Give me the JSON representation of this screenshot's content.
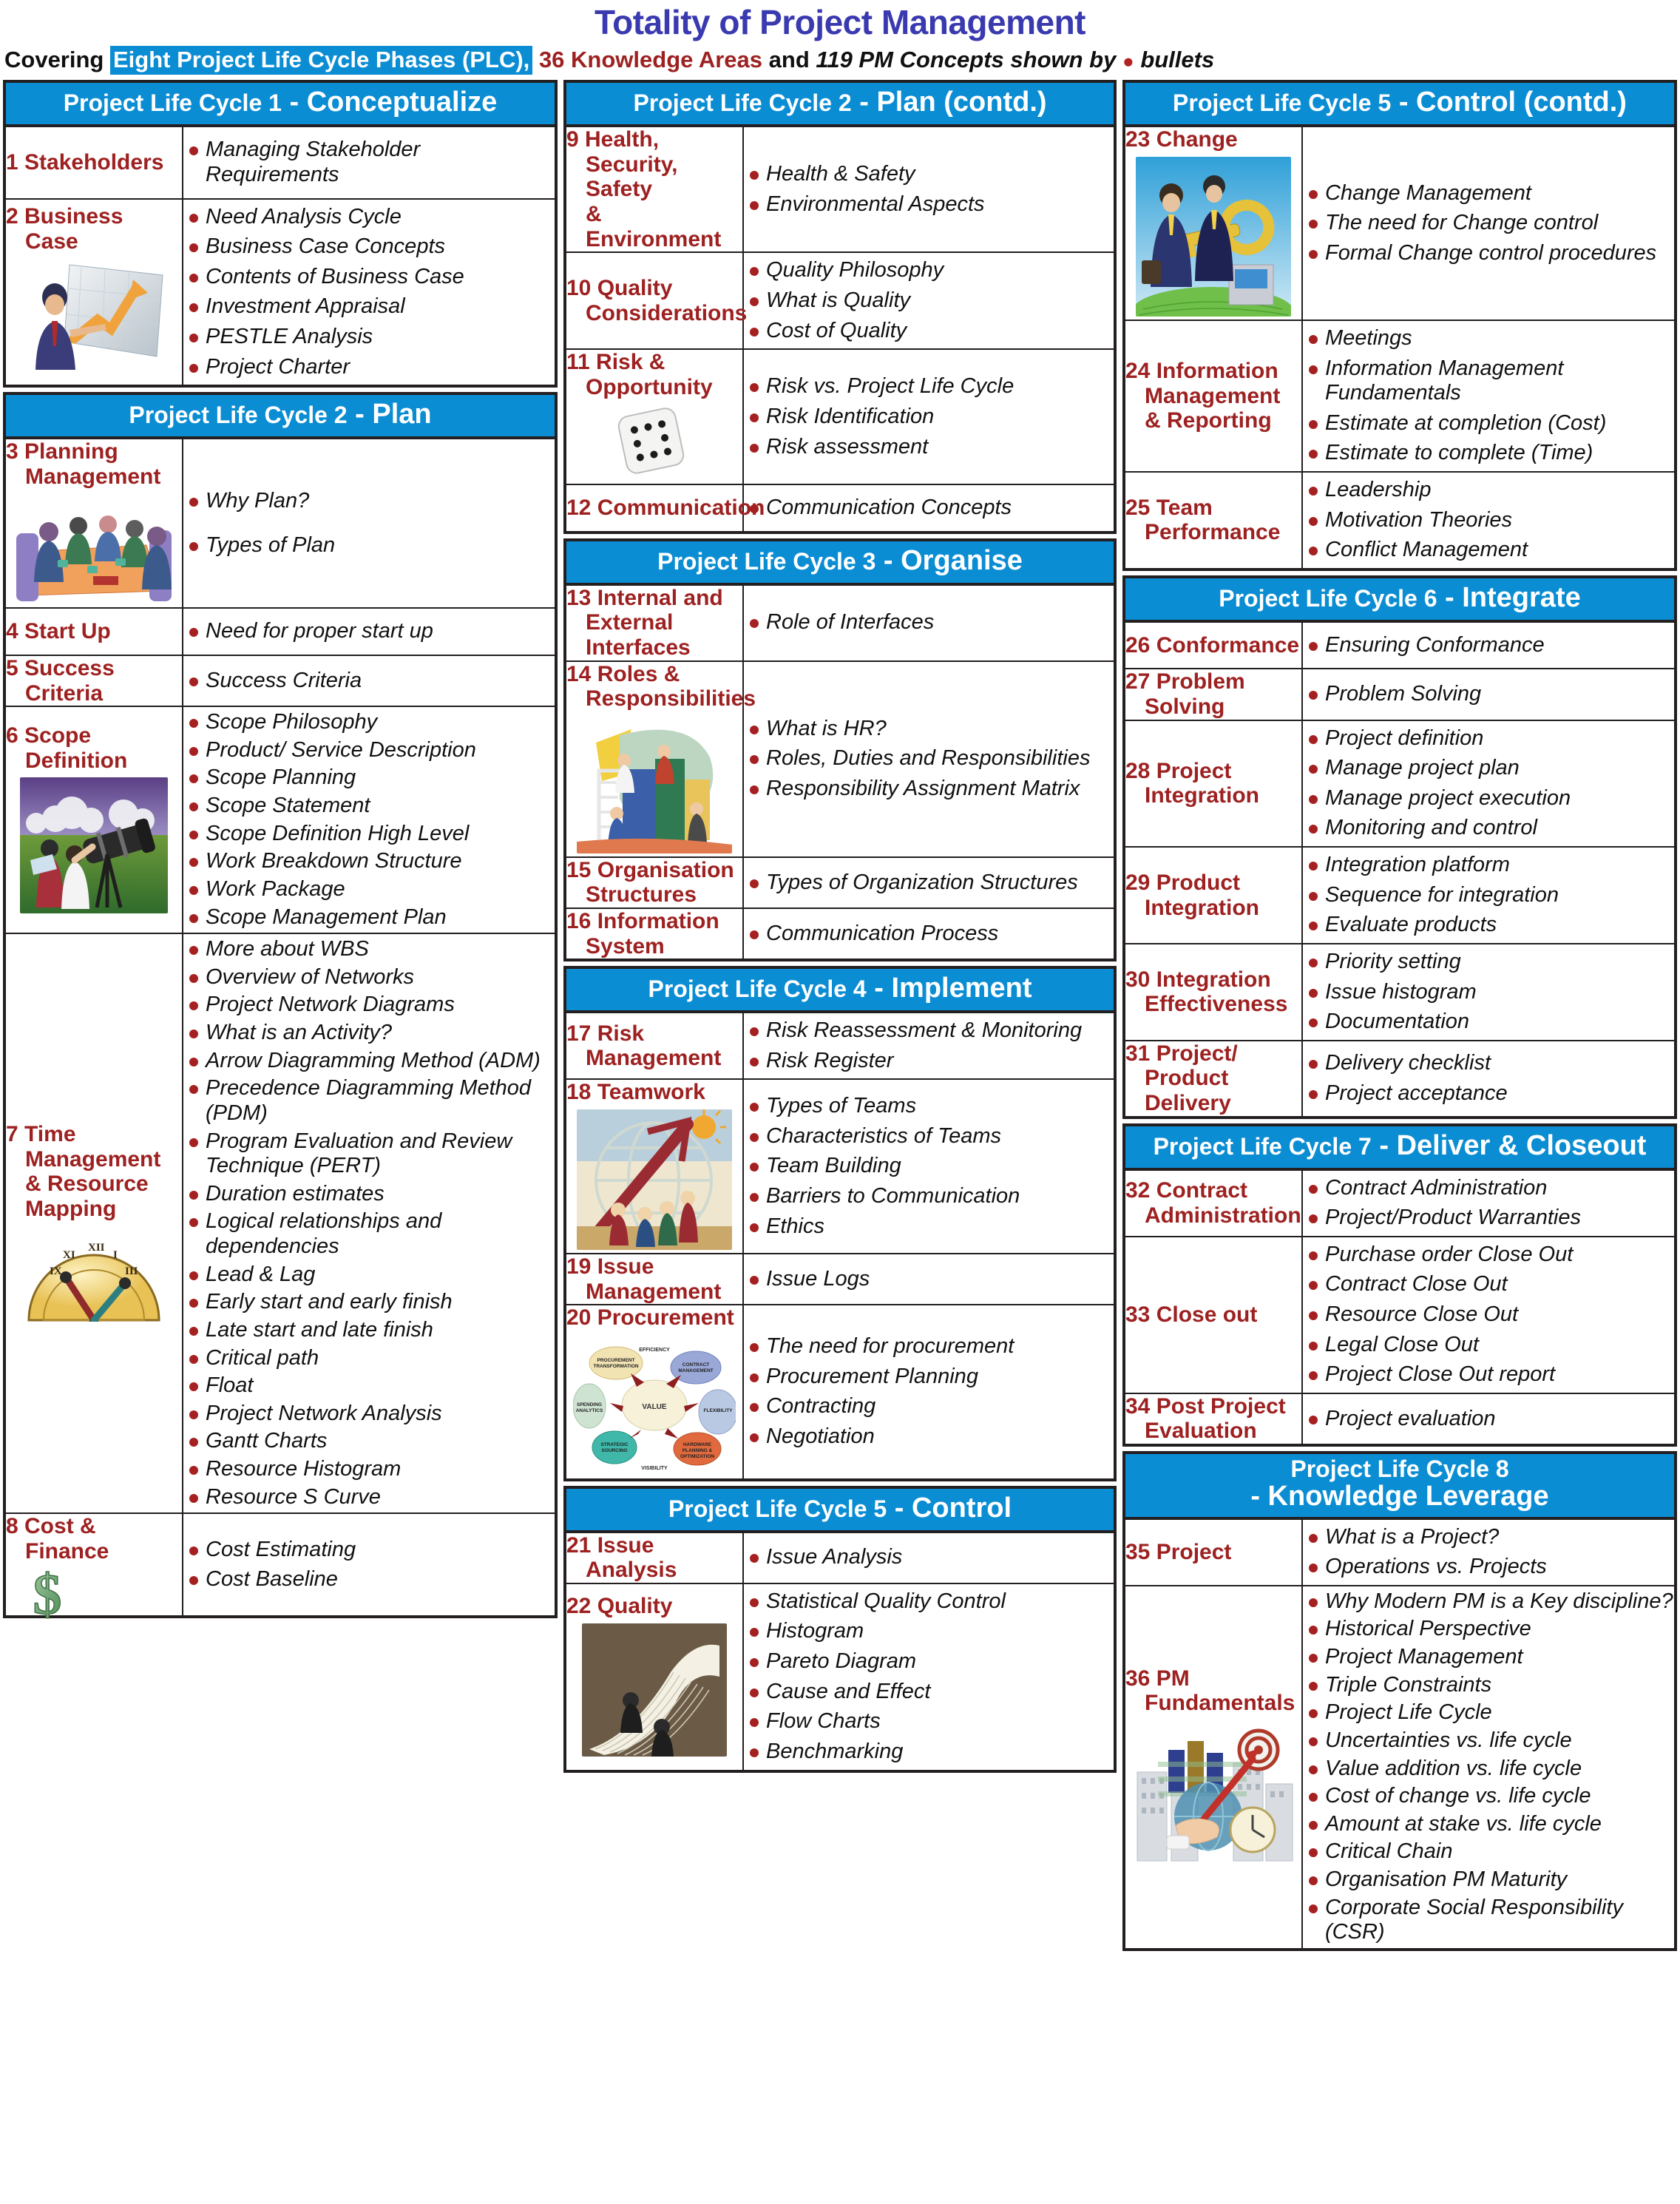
{
  "header": {
    "title": "Totality of Project Management",
    "subtitle": {
      "covering": "Covering",
      "phases": "Eight Project Life Cycle Phases (PLC),",
      "knowledge_areas": "36 Knowledge Areas",
      "and": "and",
      "concepts": "119 PM Concepts shown by",
      "bullets": "bullets"
    }
  },
  "colors": {
    "plc_bar": "#0b8dd3",
    "knowledge_area": "#9e2121",
    "title": "#3a3ab0",
    "bullet": "#a52020",
    "border": "#231f20"
  },
  "columns": [
    {
      "id": "column-1",
      "blocks": [
        {
          "phase_prefix": "Project Life Cycle 1",
          "phase_name": "- Conceptualize",
          "areas": [
            {
              "num": "1",
              "name": "Stakeholders",
              "art": "none",
              "concepts": [
                "Managing Stakeholder Requirements"
              ]
            },
            {
              "num": "2",
              "name": "Business",
              "name2": "Case",
              "art": "businessman-chart",
              "concepts": [
                "Need Analysis Cycle",
                "Business Case Concepts",
                "Contents of Business Case",
                "Investment Appraisal",
                "PESTLE Analysis",
                "Project Charter"
              ]
            }
          ]
        },
        {
          "phase_prefix": "Project Life Cycle 2",
          "phase_name": "- Plan",
          "areas": [
            {
              "num": "3",
              "name": "Planning",
              "name2": "Management",
              "art": "meeting-table",
              "concepts": [
                "Why Plan?",
                "Types of Plan"
              ]
            },
            {
              "num": "4",
              "name": "Start Up",
              "art": "none",
              "concepts": [
                "Need for proper start up"
              ]
            },
            {
              "num": "5",
              "name": "Success",
              "name2": "Criteria",
              "art": "none",
              "concepts": [
                "Success Criteria"
              ]
            },
            {
              "num": "6",
              "name": "Scope",
              "name2": "Definition",
              "art": "telescope-field",
              "concepts": [
                "Scope Philosophy",
                "Product/ Service Description",
                "Scope Planning",
                "Scope Statement",
                "Scope Definition High Level",
                "Work Breakdown Structure",
                "Work Package",
                "Scope Management Plan"
              ]
            },
            {
              "num": "7",
              "name": "Time",
              "name2": "Management",
              "name3": "& Resource",
              "name4": "Mapping",
              "art": "clock-dial",
              "concepts": [
                "More about WBS",
                "Overview of Networks",
                "Project Network Diagrams",
                "What is an Activity?",
                "Arrow Diagramming Method (ADM)",
                "Precedence Diagramming Method (PDM)",
                "Program Evaluation and Review Technique (PERT)",
                "Duration estimates",
                "Logical relationships and dependencies",
                "Lead & Lag",
                "Early start and early finish",
                "Late start and late finish",
                "Critical path",
                "Float",
                "Project Network Analysis",
                "Gantt Charts",
                "Resource Histogram",
                "Resource S Curve"
              ]
            },
            {
              "num": "8",
              "name": "Cost &",
              "name2": "Finance",
              "art": "dollar-sign",
              "concepts": [
                "Cost Estimating",
                "Cost Baseline"
              ]
            }
          ]
        }
      ]
    },
    {
      "id": "column-2",
      "blocks": [
        {
          "phase_prefix": "Project Life Cycle 2",
          "phase_name": "- Plan (contd.)",
          "areas": [
            {
              "num": "9",
              "name": "Health,",
              "name2": "Security, Safety",
              "name3": "& Environment",
              "art": "none",
              "concepts": [
                "Health & Safety",
                "Environmental Aspects"
              ]
            },
            {
              "num": "10",
              "name": "Quality",
              "name2": "Considerations",
              "art": "none",
              "concepts": [
                "Quality Philosophy",
                "What is Quality",
                "Cost of Quality"
              ]
            },
            {
              "num": "11",
              "name": "Risk &",
              "name2": "Opportunity",
              "art": "dice",
              "concepts": [
                "Risk vs. Project Life Cycle",
                "Risk Identification",
                "Risk assessment"
              ]
            },
            {
              "num": "12",
              "name": "Communication",
              "art": "none",
              "concepts": [
                "Communication Concepts"
              ]
            }
          ]
        },
        {
          "phase_prefix": "Project Life Cycle 3",
          "phase_name": "- Organise",
          "areas": [
            {
              "num": "13",
              "name": "Internal and",
              "name2": "External",
              "name3": "Interfaces",
              "art": "none",
              "concepts": [
                "Role of Interfaces"
              ]
            },
            {
              "num": "14",
              "name": "Roles &",
              "name2": "Responsibilities",
              "art": "team-building-blocks",
              "concepts": [
                "What is HR?",
                "Roles, Duties and Responsibilities",
                "Responsibility Assignment Matrix"
              ]
            },
            {
              "num": "15",
              "name": "Organisation",
              "name2": "Structures",
              "art": "none",
              "concepts": [
                "Types of Organization Structures"
              ]
            },
            {
              "num": "16",
              "name": "Information",
              "name2": "System",
              "art": "none",
              "concepts": [
                "Communication Process"
              ]
            }
          ]
        },
        {
          "phase_prefix": "Project Life Cycle 4",
          "phase_name": "- Implement",
          "areas": [
            {
              "num": "17",
              "name": "Risk",
              "name2": "Management",
              "art": "none",
              "concepts": [
                "Risk Reassessment & Monitoring",
                "Risk Register"
              ]
            },
            {
              "num": "18",
              "name": "Teamwork",
              "art": "globe-arrow-team",
              "concepts": [
                "Types of Teams",
                "Characteristics of Teams",
                "Team Building",
                "Barriers to Communication",
                "Ethics"
              ]
            },
            {
              "num": "19",
              "name": "Issue",
              "name2": "Management",
              "art": "none",
              "concepts": [
                "Issue Logs"
              ]
            },
            {
              "num": "20",
              "name": "Procurement",
              "art": "procurement-cycle",
              "concepts": [
                "The need for procurement",
                "Procurement Planning",
                "Contracting",
                "Negotiation"
              ]
            }
          ]
        },
        {
          "phase_prefix": "Project Life Cycle 5",
          "phase_name": "- Control",
          "areas": [
            {
              "num": "21",
              "name": "Issue",
              "name2": "Analysis",
              "art": "none",
              "concepts": [
                "Issue Analysis"
              ]
            },
            {
              "num": "22",
              "name": "Quality",
              "art": "paper-roll",
              "concepts": [
                "Statistical Quality Control",
                "Histogram",
                "Pareto Diagram",
                "Cause and Effect",
                "Flow Charts",
                "Benchmarking"
              ]
            }
          ]
        }
      ]
    },
    {
      "id": "column-3",
      "blocks": [
        {
          "phase_prefix": "Project Life Cycle 5",
          "phase_name": "- Control (contd.)",
          "areas": [
            {
              "num": "23",
              "name": "Change",
              "art": "key-businessmen",
              "concepts": [
                "Change Management",
                "The need for Change control",
                "Formal Change control procedures"
              ]
            },
            {
              "num": "24",
              "name": "Information",
              "name2": "Management",
              "name3": "& Reporting",
              "art": "none",
              "concepts": [
                "Meetings",
                "Information Management Fundamentals",
                "Estimate at completion (Cost)",
                "Estimate to complete (Time)"
              ]
            },
            {
              "num": "25",
              "name": "Team",
              "name2": "Performance",
              "art": "none",
              "concepts": [
                "Leadership",
                "Motivation Theories",
                "Conflict Management"
              ]
            }
          ]
        },
        {
          "phase_prefix": "Project Life Cycle 6",
          "phase_name": "- Integrate",
          "areas": [
            {
              "num": "26",
              "name": "Conformance",
              "art": "none",
              "concepts": [
                "Ensuring Conformance"
              ]
            },
            {
              "num": "27",
              "name": "Problem",
              "name2": "Solving",
              "art": "none",
              "concepts": [
                "Problem Solving"
              ]
            },
            {
              "num": "28",
              "name": "Project",
              "name2": "Integration",
              "art": "none",
              "concepts": [
                "Project definition",
                "Manage project plan",
                "Manage project execution",
                "Monitoring and control"
              ]
            },
            {
              "num": "29",
              "name": "Product",
              "name2": "Integration",
              "art": "none",
              "concepts": [
                "Integration platform",
                "Sequence for integration",
                "Evaluate products"
              ]
            },
            {
              "num": "30",
              "name": "Integration",
              "name2": "Effectiveness",
              "art": "none",
              "concepts": [
                "Priority setting",
                "Issue histogram",
                "Documentation"
              ]
            },
            {
              "num": "31",
              "name": "Project/",
              "name2": "Product",
              "name3": "Delivery",
              "art": "none",
              "concepts": [
                "Delivery checklist",
                "Project acceptance"
              ]
            }
          ]
        },
        {
          "phase_prefix": "Project Life Cycle 7",
          "phase_name": "- Deliver & Closeout",
          "areas": [
            {
              "num": "32",
              "name": "Contract",
              "name2": "Administration",
              "art": "none",
              "concepts": [
                "Contract Administration",
                "Project/Product Warranties"
              ]
            },
            {
              "num": "33",
              "name": "Close out",
              "art": "none",
              "concepts": [
                "Purchase order Close Out",
                "Contract Close Out",
                "Resource Close Out",
                "Legal Close Out",
                "Project Close Out report"
              ]
            },
            {
              "num": "34",
              "name": "Post Project",
              "name2": "Evaluation",
              "art": "none",
              "concepts": [
                "Project evaluation"
              ]
            }
          ]
        },
        {
          "phase_prefix": "Project Life Cycle 8",
          "phase_name": "- Knowledge Leverage",
          "two_line": true,
          "areas": [
            {
              "num": "35",
              "name": "Project",
              "art": "none",
              "concepts": [
                "What is a Project?",
                "Operations vs. Projects"
              ]
            },
            {
              "num": "36",
              "name": "PM",
              "name2": "Fundamentals",
              "art": "target-bars-hand",
              "concepts": [
                "Why Modern PM is a Key discipline?",
                "Historical Perspective",
                "Project Management",
                "Triple Constraints",
                "Project Life Cycle",
                "Uncertainties vs. life cycle",
                "Value addition vs. life cycle",
                "Cost of change vs. life cycle",
                "Amount at stake vs. life cycle",
                "Critical Chain",
                "Organisation PM Maturity",
                "Corporate Social Responsibility (CSR)"
              ]
            }
          ]
        }
      ]
    }
  ]
}
